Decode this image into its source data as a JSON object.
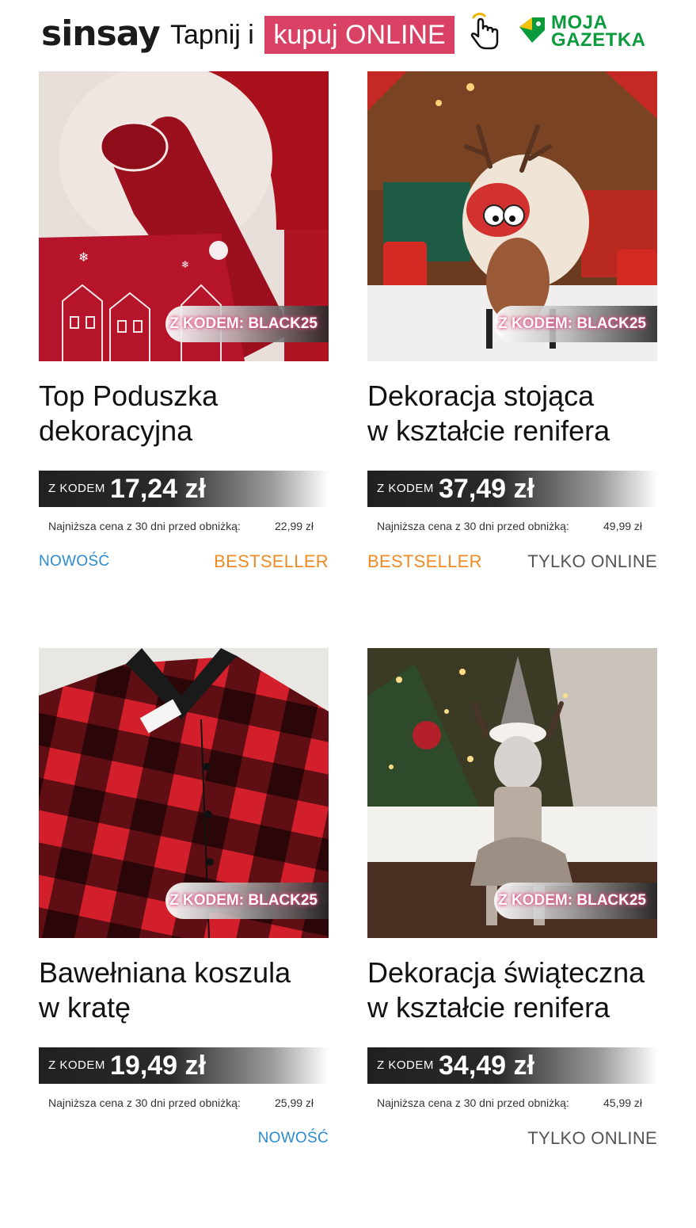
{
  "header": {
    "brand": "sinsay",
    "tap_text": "Tapnij i",
    "cta_text": "kupuj ONLINE",
    "gazetka_line1": "MOJA",
    "gazetka_line2": "GAZETKA",
    "icons": [
      "hand-pointer-icon",
      "moja-gazetka-logo-icon"
    ],
    "colors": {
      "cta": "#d94264",
      "gazetka": "#0b9a3c"
    }
  },
  "products": [
    {
      "badge": "Z KODEM: BLACK25",
      "title_line1": "Top Poduszka",
      "title_line2": "dekoracyjna",
      "price_label": "Z KODEM",
      "price": "17,24 zł",
      "lowest_label": "Najniższa cena z 30 dni przed obniżką:",
      "lowest_price": "22,99 zł",
      "tag_left": "NOWOŚĆ",
      "tag_right": "BESTSELLER"
    },
    {
      "badge": "Z KODEM: BLACK25",
      "title_line1": "Dekoracja stojąca",
      "title_line2": "w kształcie renifera",
      "price_label": "Z KODEM",
      "price": "37,49 zł",
      "lowest_label": "Najniższa cena z 30 dni przed obniżką:",
      "lowest_price": "49,99 zł",
      "tag_left": "BESTSELLER",
      "tag_right": "TYLKO ONLINE"
    },
    {
      "badge": "Z KODEM: BLACK25",
      "title_line1": "Bawełniana koszula",
      "title_line2": "w kratę",
      "price_label": "Z KODEM",
      "price": "19,49 zł",
      "lowest_label": "Najniższa cena z 30 dni przed obniżką:",
      "lowest_price": "25,99 zł",
      "tag_left": "",
      "tag_right": "NOWOŚĆ"
    },
    {
      "badge": "Z KODEM: BLACK25",
      "title_line1": "Dekoracja świąteczna",
      "title_line2": "w kształcie renifera",
      "price_label": "Z KODEM",
      "price": "34,49 zł",
      "lowest_label": "Najniższa cena z 30 dni przed obniżką:",
      "lowest_price": "45,99 zł",
      "tag_left": "",
      "tag_right": "TYLKO ONLINE"
    }
  ],
  "tag_colors": {
    "NOWOŚĆ": "#2b8bd0",
    "BESTSELLER": "#f08a24",
    "TYLKO ONLINE": "#555555"
  }
}
